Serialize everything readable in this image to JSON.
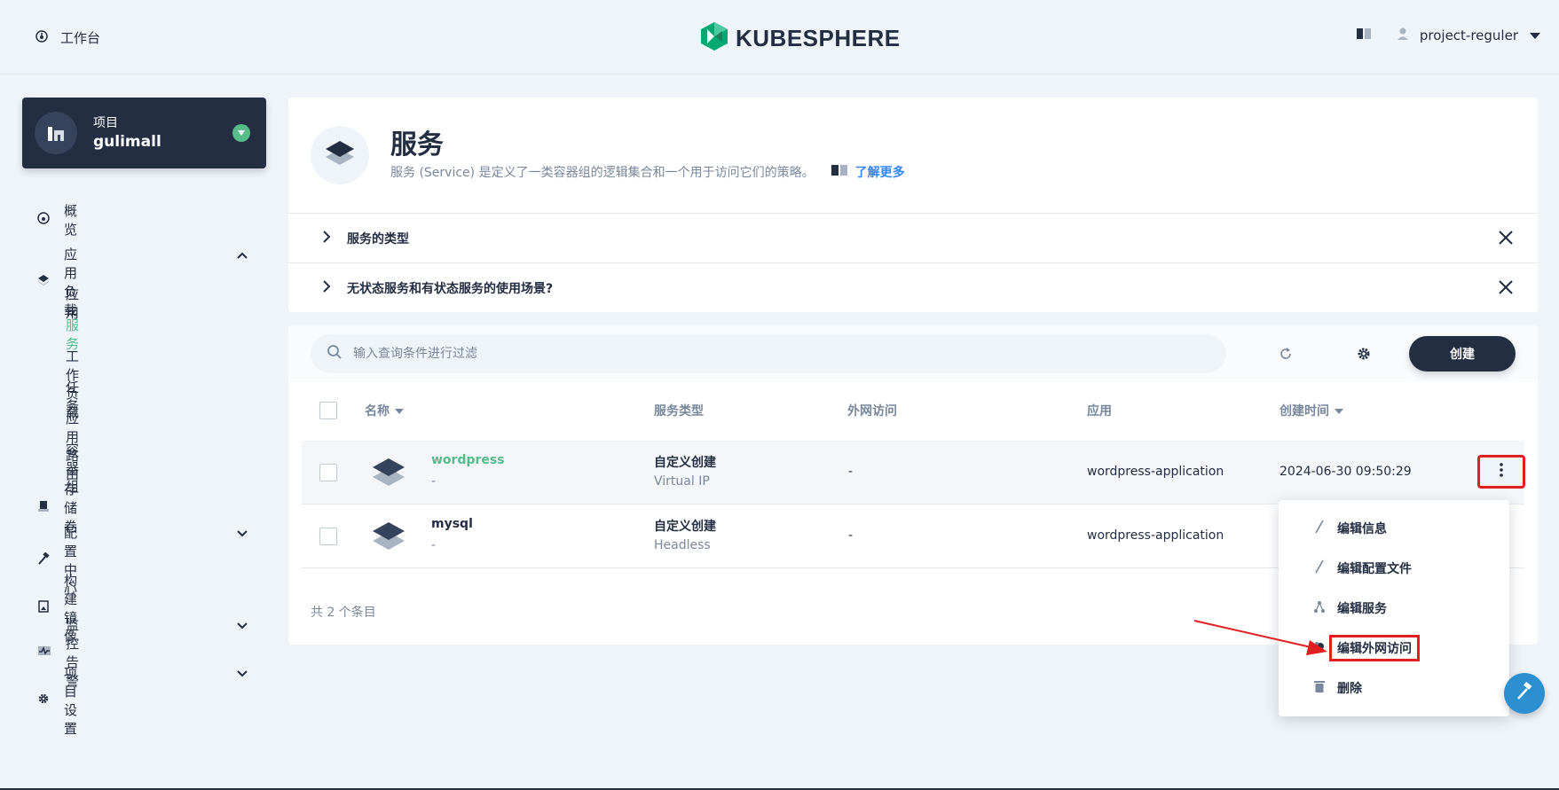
{
  "topbar": {
    "workbench_label": "工作台",
    "logo_text": "KUBESPHERE",
    "username": "project-reguler"
  },
  "project": {
    "label": "项目",
    "name": "gulimall"
  },
  "sidebar": {
    "items": [
      {
        "label": "概览",
        "icon": "dashboard-icon"
      },
      {
        "label": "应用负载",
        "icon": "layers-icon",
        "expanded": true
      },
      {
        "label": "存储卷",
        "icon": "storage-icon"
      },
      {
        "label": "配置中心",
        "icon": "hammer-icon"
      },
      {
        "label": "构建镜像",
        "icon": "image-icon"
      },
      {
        "label": "监控告警",
        "icon": "monitor-icon"
      },
      {
        "label": "项目设置",
        "icon": "gear-icon"
      }
    ],
    "subitems": [
      "应用",
      "服务",
      "工作负载",
      "任务",
      "应用路由",
      "容器组"
    ],
    "active_subitem": "服务"
  },
  "header": {
    "title": "服务",
    "description": "服务 (Service) 是定义了一类容器组的逻辑集合和一个用于访问它们的策略。",
    "learn_more": "了解更多"
  },
  "tips": [
    {
      "label": "服务的类型"
    },
    {
      "label": "无状态服务和有状态服务的使用场景?"
    }
  ],
  "toolbar": {
    "search_placeholder": "输入查询条件进行过滤",
    "create_label": "创建"
  },
  "table": {
    "columns": [
      "名称",
      "服务类型",
      "外网访问",
      "应用",
      "创建时间"
    ],
    "rows": [
      {
        "name": "wordpress",
        "desc": "-",
        "type": "自定义创建",
        "type_sub": "Virtual IP",
        "external": "-",
        "app": "wordpress-application",
        "created": "2024-06-30 09:50:29"
      },
      {
        "name": "mysql",
        "desc": "-",
        "type": "自定义创建",
        "type_sub": "Headless",
        "external": "-",
        "app": "wordpress-application",
        "created": ""
      }
    ],
    "total": "共 2 个条目"
  },
  "dropdown": {
    "items": [
      {
        "label": "编辑信息",
        "icon": "pencil-icon"
      },
      {
        "label": "编辑配置文件",
        "icon": "pencil-icon"
      },
      {
        "label": "编辑服务",
        "icon": "network-icon"
      },
      {
        "label": "编辑外网访问",
        "icon": "globe-icon"
      },
      {
        "label": "删除",
        "icon": "trash-icon"
      }
    ]
  },
  "colors": {
    "dark": "#242e42",
    "green": "#55bc8a",
    "muted": "#79879c",
    "annotation_red": "#e02020",
    "bg": "#eff4f9"
  }
}
